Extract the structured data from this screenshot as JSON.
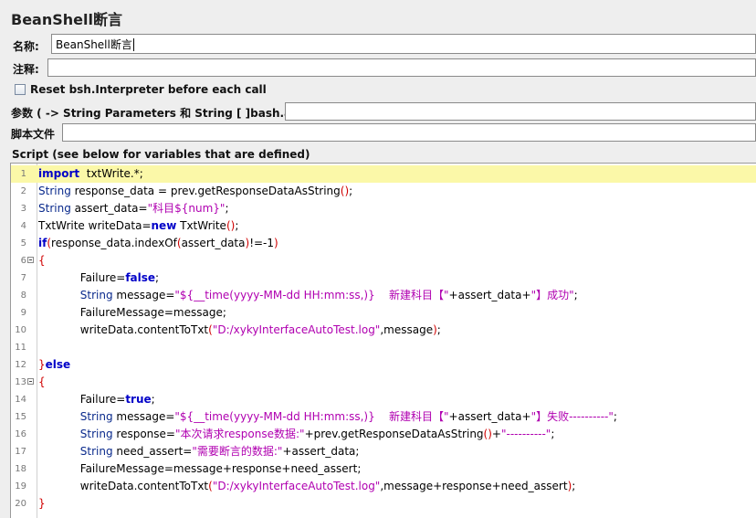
{
  "window_title": "BeanShell断言",
  "name_label": "名称:",
  "name_value": "BeanShell断言",
  "comment_label": "注释:",
  "comment_value": "",
  "reset_checkbox_label": "Reset bsh.Interpreter before each call",
  "params_label": "参数 ( -> String Parameters 和 String [ ]bash.args)",
  "params_value": "",
  "script_file_label": "脚本文件",
  "script_file_value": "",
  "script_section_label": "Script (see below for variables that are defined)",
  "code_lines": [
    {
      "n": "1",
      "fold": false,
      "highlight": true,
      "segs": [
        [
          "kw",
          "import"
        ],
        [
          "",
          "  txtWrite.*;"
        ]
      ]
    },
    {
      "n": "2",
      "fold": false,
      "highlight": false,
      "segs": [
        [
          "ty",
          "String"
        ],
        [
          "",
          " response_data = prev.getResponseDataAsString"
        ],
        [
          "br",
          "()"
        ],
        [
          "",
          ";"
        ]
      ]
    },
    {
      "n": "3",
      "fold": false,
      "highlight": false,
      "segs": [
        [
          "ty",
          "String"
        ],
        [
          "",
          " assert_data="
        ],
        [
          "st",
          "\"科目${num}\""
        ],
        [
          "",
          ";"
        ]
      ]
    },
    {
      "n": "4",
      "fold": false,
      "highlight": false,
      "segs": [
        [
          "",
          "TxtWrite writeData="
        ],
        [
          "kw",
          "new"
        ],
        [
          "",
          " TxtWrite"
        ],
        [
          "br",
          "()"
        ],
        [
          "",
          ";"
        ]
      ]
    },
    {
      "n": "5",
      "fold": false,
      "highlight": false,
      "segs": [
        [
          "kw",
          "if"
        ],
        [
          "br",
          "("
        ],
        [
          "",
          "response_data.indexOf"
        ],
        [
          "br",
          "("
        ],
        [
          "",
          "assert_data"
        ],
        [
          "br",
          ")"
        ],
        [
          "",
          "!=-1"
        ],
        [
          "br",
          ")"
        ]
      ]
    },
    {
      "n": "6",
      "fold": true,
      "highlight": false,
      "segs": [
        [
          "br",
          "{"
        ]
      ]
    },
    {
      "n": "7",
      "fold": false,
      "highlight": false,
      "segs": [
        [
          "",
          "            Failure="
        ],
        [
          "kw",
          "false"
        ],
        [
          "",
          ";"
        ]
      ]
    },
    {
      "n": "8",
      "fold": false,
      "highlight": false,
      "segs": [
        [
          "ty",
          "            String"
        ],
        [
          "",
          " message="
        ],
        [
          "st",
          "\"${__time(yyyy-MM-dd HH:mm:ss,)}    新建科目【\""
        ],
        [
          "",
          "+assert_data+"
        ],
        [
          "st",
          "\"】成功\""
        ],
        [
          "",
          ";"
        ]
      ]
    },
    {
      "n": "9",
      "fold": false,
      "highlight": false,
      "segs": [
        [
          "",
          "            FailureMessage=message;"
        ]
      ]
    },
    {
      "n": "10",
      "fold": false,
      "highlight": false,
      "segs": [
        [
          "",
          "            writeData.contentToTxt"
        ],
        [
          "br",
          "("
        ],
        [
          "st",
          "\"D:/xykyInterfaceAutoTest.log\""
        ],
        [
          "",
          ",message"
        ],
        [
          "br",
          ")"
        ],
        [
          "",
          ";"
        ]
      ]
    },
    {
      "n": "11",
      "fold": false,
      "highlight": false,
      "segs": [
        [
          "",
          ""
        ]
      ]
    },
    {
      "n": "12",
      "fold": false,
      "highlight": false,
      "segs": [
        [
          "br",
          "}"
        ],
        [
          "kw",
          "else"
        ]
      ]
    },
    {
      "n": "13",
      "fold": true,
      "highlight": false,
      "segs": [
        [
          "br",
          "{"
        ]
      ]
    },
    {
      "n": "14",
      "fold": false,
      "highlight": false,
      "segs": [
        [
          "",
          "            Failure="
        ],
        [
          "kw",
          "true"
        ],
        [
          "",
          ";"
        ]
      ]
    },
    {
      "n": "15",
      "fold": false,
      "highlight": false,
      "segs": [
        [
          "ty",
          "            String"
        ],
        [
          "",
          " message="
        ],
        [
          "st",
          "\"${__time(yyyy-MM-dd HH:mm:ss,)}    新建科目【\""
        ],
        [
          "",
          "+assert_data+"
        ],
        [
          "st",
          "\"】失败----------\""
        ],
        [
          "",
          ";"
        ]
      ]
    },
    {
      "n": "16",
      "fold": false,
      "highlight": false,
      "segs": [
        [
          "ty",
          "            String"
        ],
        [
          "",
          " response="
        ],
        [
          "st",
          "\"本次请求response数据:\""
        ],
        [
          "",
          "+prev.getResponseDataAsString"
        ],
        [
          "br",
          "()"
        ],
        [
          "",
          "+"
        ],
        [
          "st",
          "\"----------\""
        ],
        [
          "",
          ";"
        ]
      ]
    },
    {
      "n": "17",
      "fold": false,
      "highlight": false,
      "segs": [
        [
          "ty",
          "            String"
        ],
        [
          "",
          " need_assert="
        ],
        [
          "st",
          "\"需要断言的数据:\""
        ],
        [
          "",
          "+assert_data;"
        ]
      ]
    },
    {
      "n": "18",
      "fold": false,
      "highlight": false,
      "segs": [
        [
          "",
          "            FailureMessage=message+response+need_assert;"
        ]
      ]
    },
    {
      "n": "19",
      "fold": false,
      "highlight": false,
      "segs": [
        [
          "",
          "            writeData.contentToTxt"
        ],
        [
          "br",
          "("
        ],
        [
          "st",
          "\"D:/xykyInterfaceAutoTest.log\""
        ],
        [
          "",
          ",message+response+need_assert"
        ],
        [
          "br",
          ")"
        ],
        [
          "",
          ";"
        ]
      ]
    },
    {
      "n": "20",
      "fold": false,
      "highlight": false,
      "segs": [
        [
          "br",
          "}"
        ]
      ]
    }
  ]
}
